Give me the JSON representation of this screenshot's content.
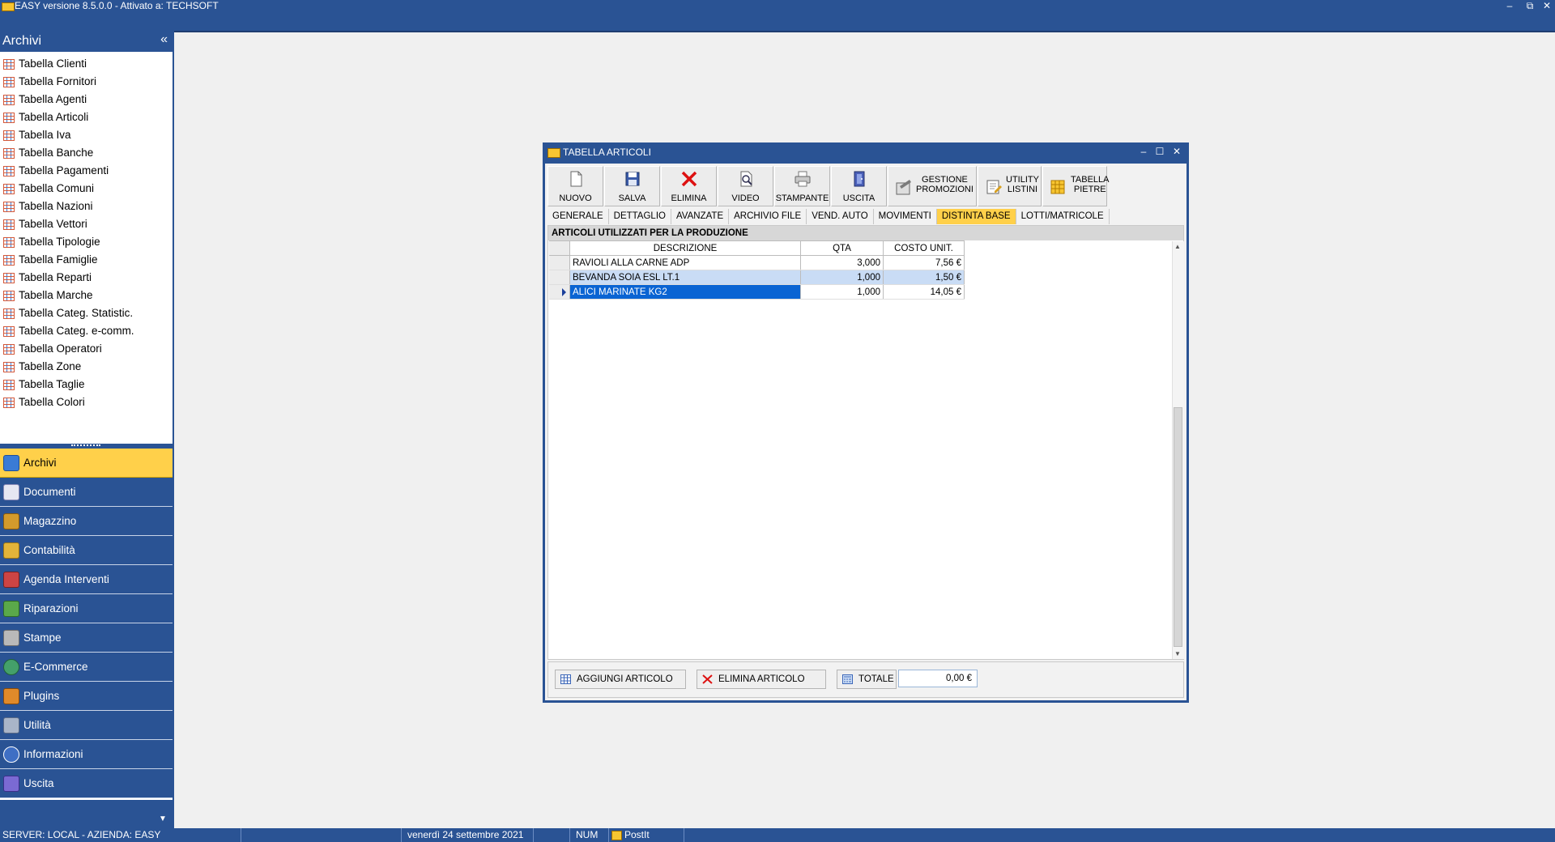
{
  "app": {
    "title": "EASY versione 8.5.0.0 - Attivato a: TECHSOFT",
    "window_controls": [
      "–",
      "⧉",
      "✕"
    ]
  },
  "sidebar": {
    "header": "Archivi",
    "collapse_glyph": "«",
    "archivi_items": [
      "Tabella Clienti",
      "Tabella Fornitori",
      "Tabella Agenti",
      "Tabella Articoli",
      "Tabella Iva",
      "Tabella Banche",
      "Tabella Pagamenti",
      "Tabella Comuni",
      "Tabella Nazioni",
      "Tabella Vettori",
      "Tabella Tipologie",
      "Tabella Famiglie",
      "Tabella Reparti",
      "Tabella Marche",
      "Tabella Categ. Statistic.",
      "Tabella Categ. e-comm.",
      "Tabella Operatori",
      "Tabella Zone",
      "Tabella Taglie",
      "Tabella Colori"
    ],
    "nav": [
      {
        "label": "Archivi",
        "icon": "archive-icon",
        "active": true
      },
      {
        "label": "Documenti",
        "icon": "document-icon"
      },
      {
        "label": "Magazzino",
        "icon": "warehouse-icon"
      },
      {
        "label": "Contabilità",
        "icon": "scales-icon"
      },
      {
        "label": "Agenda Interventi",
        "icon": "agenda-icon"
      },
      {
        "label": "Riparazioni",
        "icon": "repair-icon"
      },
      {
        "label": "Stampe",
        "icon": "printer-icon"
      },
      {
        "label": "E-Commerce",
        "icon": "globe-icon"
      },
      {
        "label": "Plugins",
        "icon": "plugin-icon"
      },
      {
        "label": "Utilità",
        "icon": "tools-icon"
      },
      {
        "label": "Informazioni",
        "icon": "info-icon"
      },
      {
        "label": "Uscita",
        "icon": "exit-icon"
      }
    ]
  },
  "status_bar": {
    "server": "SERVER: LOCAL - AZIENDA: EASY",
    "date": "venerdì 24 settembre 2021",
    "num": "NUM",
    "postit": "PostIt"
  },
  "child_window": {
    "title": "TABELLA ARTICOLI",
    "controls": [
      "–",
      "☐",
      "✕"
    ],
    "toolbar": {
      "nuovo": "NUOVO",
      "salva": "SALVA",
      "elimina": "ELIMINA",
      "video": "VIDEO",
      "stampante": "STAMPANTE",
      "uscita": "USCITA",
      "promo_1": "GESTIONE",
      "promo_2": "PROMOZIONI",
      "listini_1": "UTILITY",
      "listini_2": "LISTINI",
      "pietre_1": "TABELLA",
      "pietre_2": "PIETRE"
    },
    "tabs": [
      "GENERALE",
      "DETTAGLIO",
      "AVANZATE",
      "ARCHIVIO FILE",
      "VEND. AUTO",
      "MOVIMENTI",
      "DISTINTA BASE",
      "LOTTI/MATRICOLE"
    ],
    "active_tab": "DISTINTA BASE",
    "grid_caption": "ARTICOLI UTILIZZATI PER LA PRODUZIONE",
    "columns": [
      "DESCRIZIONE",
      "QTA",
      "COSTO UNIT."
    ],
    "rows": [
      {
        "descrizione": "RAVIOLI ALLA CARNE ADP",
        "qta": "3,000",
        "costo": "7,56 €"
      },
      {
        "descrizione": "BEVANDA SOIA ESL LT.1",
        "qta": "1,000",
        "costo": "1,50 €"
      },
      {
        "descrizione": "ALICI MARINATE KG2",
        "qta": "1,000",
        "costo": "14,05 €"
      }
    ],
    "buttons": {
      "aggiungi": "AGGIUNGI ARTICOLO",
      "elimina_art": "ELIMINA ARTICOLO",
      "totale": "TOTALE"
    },
    "totale_value": "0,00 €"
  },
  "colors": {
    "chrome_blue": "#2a5394",
    "active_yellow": "#ffd04a",
    "selection_blue": "#0a64d3"
  }
}
